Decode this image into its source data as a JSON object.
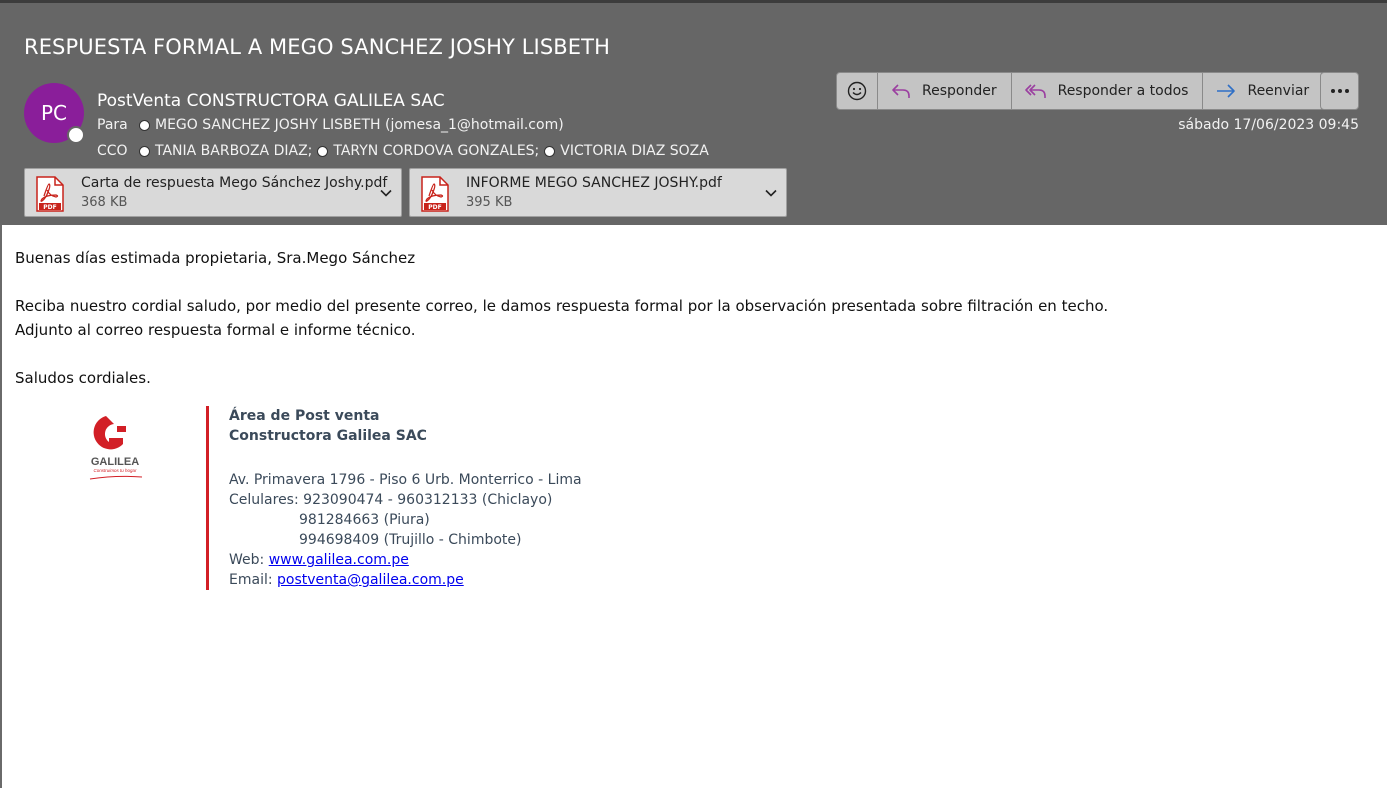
{
  "subject": "RESPUESTA FORMAL A MEGO SANCHEZ JOSHY LISBETH",
  "avatar_initials": "PC",
  "sender": "PostVenta CONSTRUCTORA GALILEA SAC",
  "to": {
    "label": "Para",
    "recipients": [
      "MEGO SANCHEZ JOSHY LISBETH (jomesa_1@hotmail.com)"
    ]
  },
  "cco": {
    "label": "CCO",
    "recipients": [
      "TANIA BARBOZA DIAZ;",
      "TARYN CORDOVA GONZALES;",
      "VICTORIA DIAZ SOZA"
    ]
  },
  "date": "sábado 17/06/2023 09:45",
  "toolbar": {
    "emoji_icon": "smiley-icon",
    "reply": "Responder",
    "reply_all": "Responder a todos",
    "forward": "Reenviar",
    "more_icon": "more-icon"
  },
  "attachments": [
    {
      "name": "Carta de respuesta Mego Sánchez Joshy.pdf",
      "size": "368 KB",
      "icon": "pdf-icon"
    },
    {
      "name": "INFORME MEGO SANCHEZ JOSHY.pdf",
      "size": "395 KB",
      "icon": "pdf-icon"
    }
  ],
  "body": {
    "greeting": "Buenas días estimada propietaria, Sra.Mego Sánchez",
    "line1": "Reciba nuestro cordial saludo, por medio del presente correo, le damos respuesta formal por la observación presentada sobre filtración en techo.",
    "line2": "Adjunto al correo respuesta formal e informe técnico.",
    "closing": "Saludos cordiales."
  },
  "signature": {
    "logo_text": "GALILEA",
    "logo_tagline": "Construimos tu hogar",
    "area": "Área de Post venta",
    "company": "Constructora Galilea SAC",
    "address": "Av. Primavera 1796 - Piso 6 Urb. Monterrico - Lima",
    "phones_label": "Celulares: ",
    "phone1": "923090474 - 960312133 (Chiclayo)",
    "phone2": "981284663 (Piura)",
    "phone3": "994698409 (Trujillo - Chimbote)",
    "web_label": "Web: ",
    "web": "www.galilea.com.pe",
    "email_label": "Email: ",
    "email": "postventa@galilea.com.pe"
  },
  "colors": {
    "header_bg": "#666666",
    "avatar_bg": "#8a1e9a",
    "accent_red": "#d21f26",
    "reply_icon": "#9b3fa0",
    "forward_icon": "#2f6fc6"
  }
}
